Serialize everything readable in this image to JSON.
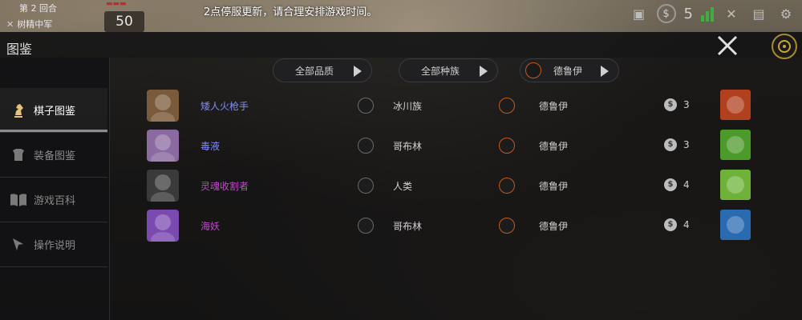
{
  "topbar": {
    "round": "第 2 回合",
    "army": "树精中军",
    "hp_value": "50",
    "notice": "2点停服更新，请合理安排游戏时间。",
    "gold": "5"
  },
  "panel": {
    "title": "图鉴"
  },
  "sidebar": {
    "items": [
      {
        "label": "棋子图鉴",
        "icon": "knight-icon",
        "active": true
      },
      {
        "label": "装备图鉴",
        "icon": "armor-icon",
        "active": false
      },
      {
        "label": "游戏百科",
        "icon": "book-icon",
        "active": false
      },
      {
        "label": "操作说明",
        "icon": "pointer-icon",
        "active": false
      }
    ]
  },
  "filters": {
    "quality": "全部品质",
    "race": "全部种族",
    "class": "德鲁伊"
  },
  "pieces": [
    {
      "name": "矮人火枪手",
      "name_color": "#7f8cff",
      "race": "冰川族",
      "class": "德鲁伊",
      "cost": "3",
      "portrait_color": "#7a5a3a",
      "skill_color": "#b0401e"
    },
    {
      "name": "毒液",
      "name_color": "#7f8cff",
      "race": "哥布林",
      "class": "德鲁伊",
      "cost": "3",
      "portrait_color": "#8a6aa0",
      "skill_color": "#4c9a2a"
    },
    {
      "name": "灵魂收割者",
      "name_color": "#c04acb",
      "race": "人类",
      "class": "德鲁伊",
      "cost": "4",
      "portrait_color": "#3a3a3a",
      "skill_color": "#6fb23a"
    },
    {
      "name": "海妖",
      "name_color": "#c04acb",
      "race": "哥布林",
      "class": "德鲁伊",
      "cost": "4",
      "portrait_color": "#7a4ab0",
      "skill_color": "#2a6ab0"
    }
  ]
}
